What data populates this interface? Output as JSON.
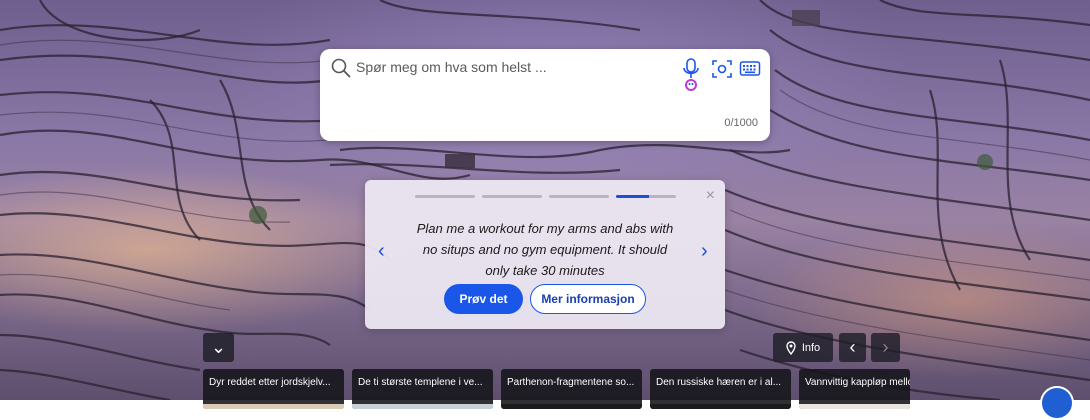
{
  "search": {
    "placeholder": "Spør meg om hva som helst ...",
    "char_counter": "0/1000",
    "icons": [
      "search-icon",
      "microphone-icon",
      "visual-search-icon",
      "keyboard-icon"
    ]
  },
  "suggestion": {
    "text": "Plan me a workout for my arms and abs with no situps and no gym equipment. It should only take 30 minutes",
    "try_label": "Prøv det",
    "more_label": "Mer informasjon",
    "prev_glyph": "‹",
    "next_glyph": "›",
    "close_glyph": "×",
    "active_step": 4,
    "total_steps": 4
  },
  "bottom_bar": {
    "info_label": "Info",
    "collapse_glyph": "⌄",
    "prev_glyph": "‹",
    "next_glyph": "›"
  },
  "news": [
    {
      "title": "Dyr reddet etter jordskjelv..."
    },
    {
      "title": "De ti største templene i ve..."
    },
    {
      "title": "Parthenon-fragmentene so..."
    },
    {
      "title": "Den russiske hæren er i al..."
    },
    {
      "title": "Vannvittig kappløp mellom"
    }
  ],
  "colors": {
    "accent": "#1a56e8",
    "card_bg": "#eeeaf4",
    "dark_overlay": "#1e1e28"
  }
}
